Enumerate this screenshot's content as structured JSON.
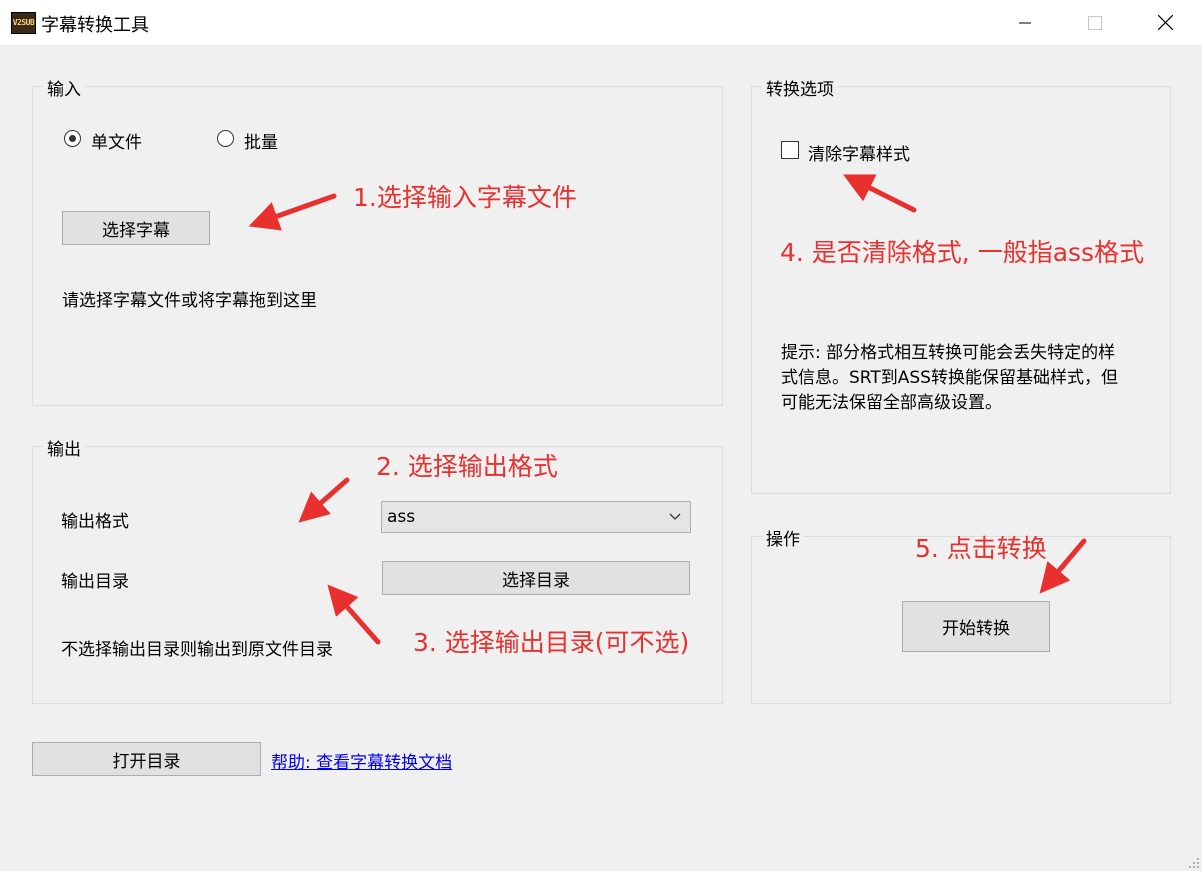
{
  "window": {
    "icon_text": "V2SUB",
    "title": "字幕转换工具"
  },
  "input_group": {
    "label": "输入",
    "radio_single": "单文件",
    "radio_batch": "批量",
    "select_button": "选择字幕",
    "hint": "请选择字幕文件或将字幕拖到这里"
  },
  "options_group": {
    "label": "转换选项",
    "checkbox_label": "清除字幕样式",
    "tip_line1": "提示: 部分格式相互转换可能会丢失特定的样",
    "tip_line2": "式信息。SRT到ASS转换能保留基础样式，但",
    "tip_line3": "可能无法保留全部高级设置。"
  },
  "output_group": {
    "label": "输出",
    "format_label": "输出格式",
    "format_value": "ass",
    "dir_label": "输出目录",
    "dir_button": "选择目录",
    "hint": "不选择输出目录则输出到原文件目录"
  },
  "action_group": {
    "label": "操作",
    "start_button": "开始转换"
  },
  "footer": {
    "open_dir_button": "打开目录",
    "help_link": "帮助: 查看字幕转换文档"
  },
  "annotations": {
    "a1": "1.选择输入字幕文件",
    "a2": "2. 选择输出格式",
    "a3": "3. 选择输出目录(可不选)",
    "a4": "4. 是否清除格式, 一般指ass格式",
    "a5": "5. 点击转换"
  },
  "colors": {
    "annotation": "#e8312f",
    "link": "#0000ee",
    "background": "#f0f0f0"
  }
}
